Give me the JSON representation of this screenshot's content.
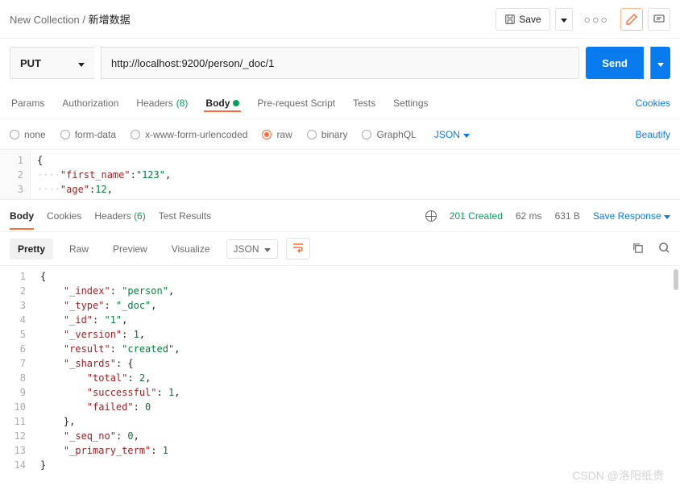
{
  "breadcrumb": {
    "collection": "New Collection",
    "separator": "/",
    "request": "新增数据"
  },
  "toolbar": {
    "save_label": "Save"
  },
  "request": {
    "method": "PUT",
    "url": "http://localhost:9200/person/_doc/1",
    "send_label": "Send"
  },
  "tabs": {
    "params": "Params",
    "auth": "Authorization",
    "headers": "Headers",
    "headers_count": "(8)",
    "body": "Body",
    "prerequest": "Pre-request Script",
    "tests": "Tests",
    "settings": "Settings",
    "cookies_link": "Cookies"
  },
  "body_opts": {
    "none": "none",
    "formdata": "form-data",
    "xwww": "x-www-form-urlencoded",
    "raw": "raw",
    "binary": "binary",
    "graphql": "GraphQL",
    "type": "JSON",
    "beautify": "Beautify"
  },
  "req_body_lines": [
    "1",
    "2",
    "3"
  ],
  "req_body": {
    "l1": "{",
    "l2_key": "\"first_name\"",
    "l2_val": "\"123\"",
    "l3_key": "\"age\"",
    "l3_val": "12"
  },
  "response": {
    "tabs": {
      "body": "Body",
      "cookies": "Cookies",
      "headers": "Headers",
      "headers_count": "(6)",
      "tests": "Test Results"
    },
    "status": "201 Created",
    "time": "62 ms",
    "size": "631 B",
    "save": "Save Response"
  },
  "view": {
    "pretty": "Pretty",
    "raw": "Raw",
    "preview": "Preview",
    "visualize": "Visualize",
    "format": "JSON"
  },
  "resp_lines": [
    "1",
    "2",
    "3",
    "4",
    "5",
    "6",
    "7",
    "8",
    "9",
    "10",
    "11",
    "12",
    "13",
    "14"
  ],
  "resp_body": {
    "l1": "{",
    "l2_k": "\"_index\"",
    "l2_v": "\"person\"",
    "l3_k": "\"_type\"",
    "l3_v": "\"_doc\"",
    "l4_k": "\"_id\"",
    "l4_v": "\"1\"",
    "l5_k": "\"_version\"",
    "l5_v": "1",
    "l6_k": "\"result\"",
    "l6_v": "\"created\"",
    "l7_k": "\"_shards\"",
    "l8_k": "\"total\"",
    "l8_v": "2",
    "l9_k": "\"successful\"",
    "l9_v": "1",
    "l10_k": "\"failed\"",
    "l10_v": "0",
    "l11": "},",
    "l12_k": "\"_seq_no\"",
    "l12_v": "0",
    "l13_k": "\"_primary_term\"",
    "l13_v": "1",
    "l14": "}"
  },
  "watermark": "CSDN @洛阳纸贵"
}
